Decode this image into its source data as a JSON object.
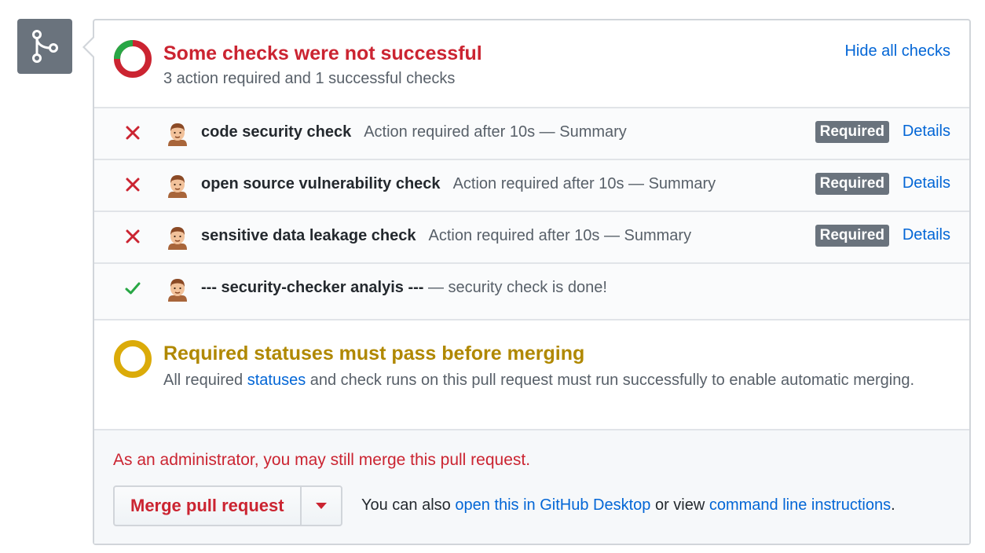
{
  "header": {
    "title": "Some checks were not successful",
    "subtitle": "3 action required and 1 successful checks",
    "hide_label": "Hide all checks"
  },
  "checks": [
    {
      "status": "failure",
      "name": "code security check",
      "description": "Action required after 10s — Summary",
      "badge": "Required",
      "details": "Details"
    },
    {
      "status": "failure",
      "name": "open source vulnerability check",
      "description": "Action required after 10s — Summary",
      "badge": "Required",
      "details": "Details"
    },
    {
      "status": "failure",
      "name": "sensitive data leakage check",
      "description": "Action required after 10s — Summary",
      "badge": "Required",
      "details": "Details"
    },
    {
      "status": "success",
      "name": "--- security-checker analyis ---",
      "description": "— security check is done!"
    }
  ],
  "required": {
    "title": "Required statuses must pass before merging",
    "text_before": "All required ",
    "link": "statuses",
    "text_after": " and check runs on this pull request must run successfully to enable automatic merging."
  },
  "footer": {
    "admin_text": "As an administrator, you may still merge this pull request.",
    "merge_label": "Merge pull request",
    "also_prefix": "You can also ",
    "desktop_link": "open this in GitHub Desktop",
    "or_view": " or view ",
    "cli_link": "command line instructions",
    "period": "."
  },
  "colors": {
    "failure": "#cb2431",
    "success": "#28a745",
    "pending": "#dbab09",
    "link": "#0366d6",
    "badge": "#6a737d"
  },
  "icons": {
    "merge": "git-merge-icon",
    "failure": "x-icon",
    "success": "check-icon",
    "avatar": "bot-avatar-icon",
    "dropdown": "triangle-down-icon"
  }
}
